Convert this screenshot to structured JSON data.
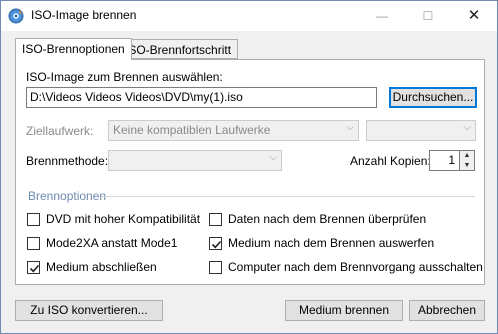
{
  "window": {
    "title": "ISO-Image brennen",
    "app_icon": "disc-burn-icon"
  },
  "tabs": [
    {
      "label": "ISO-Brennoptionen",
      "active": true
    },
    {
      "label": "ISO-Brennfortschritt",
      "active": false
    }
  ],
  "iso": {
    "label": "ISO-Image zum Brennen auswählen:",
    "path": "D:\\Videos Videos Videos\\DVD\\my(1).iso",
    "browse_label": "Durchsuchen..."
  },
  "target": {
    "label": "Ziellaufwerk:",
    "drive_value": "Keine kompatiblen Laufwerke",
    "speed_value": ""
  },
  "method": {
    "label": "Brennmethode:",
    "value": ""
  },
  "copies": {
    "label": "Anzahl Kopien:",
    "value": "1"
  },
  "options": {
    "title": "Brennoptionen",
    "items": [
      {
        "label": "DVD mit hoher Kompatibilität",
        "checked": false
      },
      {
        "label": "Mode2XA anstatt Mode1",
        "checked": false
      },
      {
        "label": "Medium abschließen",
        "checked": true
      },
      {
        "label": "Daten nach dem Brennen überprüfen",
        "checked": false
      },
      {
        "label": "Medium nach dem Brennen auswerfen",
        "checked": true
      },
      {
        "label": "Computer nach dem Brennvorgang ausschalten",
        "checked": false
      }
    ]
  },
  "buttons": {
    "convert": "Zu ISO konvertieren...",
    "burn": "Medium brennen",
    "cancel": "Abbrechen"
  },
  "colors": {
    "accent": "#0078d7",
    "group_title": "#6d8ab0",
    "disabled_text": "#8a8a8a"
  }
}
